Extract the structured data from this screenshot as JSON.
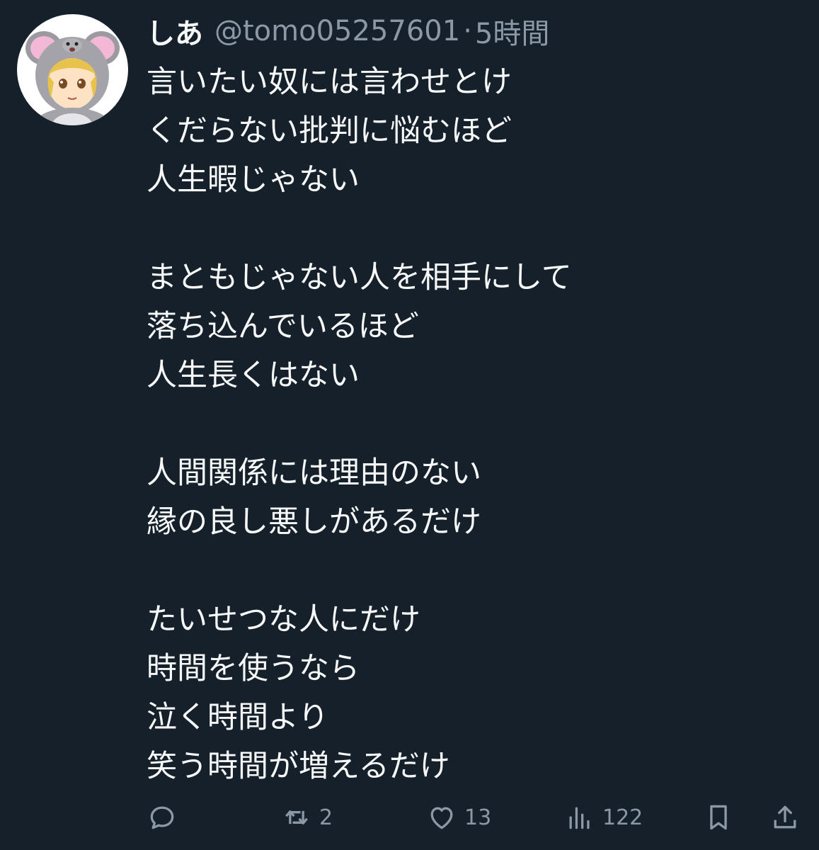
{
  "tweet": {
    "display_name": "しあ",
    "handle": "@tomo05257601",
    "separator": "·",
    "time": "5時間",
    "lines": [
      "言いたい奴には言わせとけ",
      "くだらない批判に悩むほど",
      "人生暇じゃない",
      "",
      "まともじゃない人を相手にして",
      "落ち込んでいるほど",
      "人生長くはない",
      "",
      "人間関係には理由のない",
      "縁の良し悪しがあるだけ",
      "",
      "たいせつな人にだけ",
      "時間を使うなら",
      "泣く時間より",
      "笑う時間が増えるだけ"
    ]
  },
  "actions": {
    "reply": {
      "icon": "reply-icon"
    },
    "retweet": {
      "icon": "retweet-icon",
      "count": "2"
    },
    "like": {
      "icon": "heart-icon",
      "count": "13"
    },
    "views": {
      "icon": "views-icon",
      "count": "122"
    },
    "bookmark": {
      "icon": "bookmark-icon"
    },
    "share": {
      "icon": "share-icon"
    }
  },
  "colors": {
    "background": "#15202b",
    "text_primary": "#f7f9f9",
    "text_secondary": "#8b98a5"
  }
}
